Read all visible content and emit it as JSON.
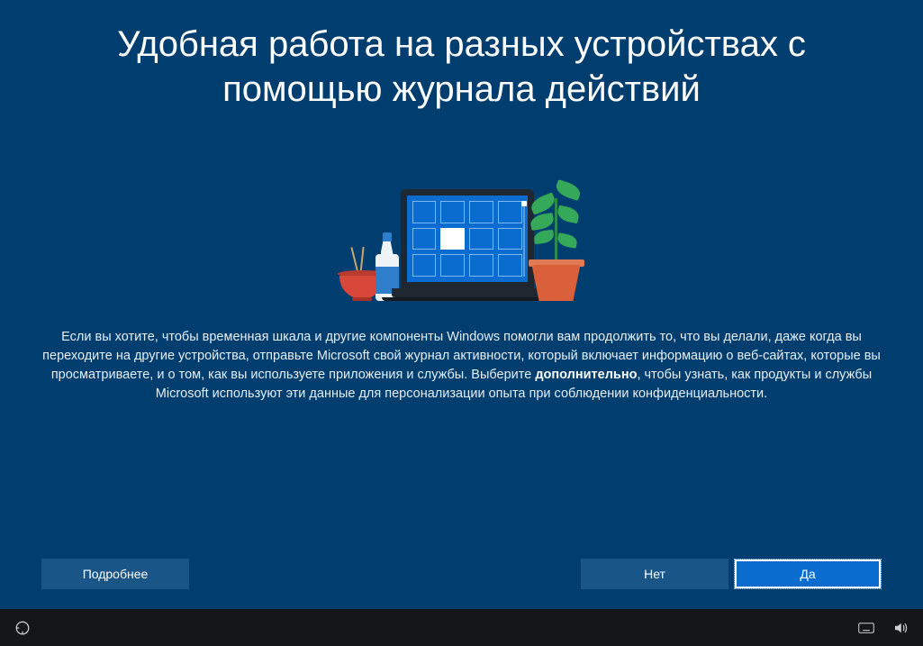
{
  "title": "Удобная работа на разных устройствах с помощью журнала действий",
  "body": {
    "part1": "Если вы хотите, чтобы временная шкала и другие компоненты Windows помогли вам продолжить то, что вы делали, даже когда вы переходите на другие устройства, отправьте Microsoft свой журнал активности, который включает информацию о веб-сайтах, которые вы просматриваете, и о том, как вы используете приложения и службы. Выберите ",
    "bold": "дополнительно",
    "part2": ", чтобы узнать, как продукты и службы Microsoft используют эти данные для персонализации опыта при соблюдении конфиденциальности."
  },
  "buttons": {
    "learn_more": "Подробнее",
    "no": "Нет",
    "yes": "Да"
  },
  "taskbar": {
    "ease_of_access": "ease-of-access",
    "keyboard": "on-screen-keyboard",
    "volume": "volume"
  },
  "colors": {
    "background": "#003e70",
    "primary_button": "#0a6cce",
    "secondary_button": "#1a5588",
    "accent_orange": "#d9603a",
    "accent_red": "#d9473a",
    "accent_green": "#35a85a"
  }
}
